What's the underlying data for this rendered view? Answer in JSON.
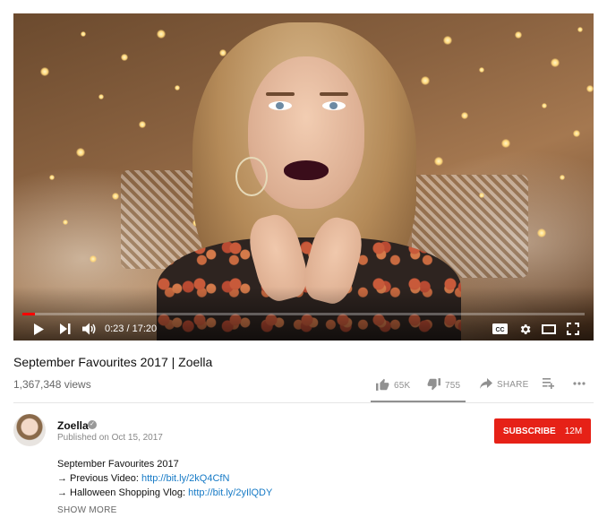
{
  "player": {
    "current_time": "0:23",
    "duration": "17:20",
    "time_display": "0:23 / 17:20",
    "progress_fraction": 0.022,
    "icons": [
      "play-icon",
      "next-icon",
      "volume-icon",
      "captions-icon",
      "settings-icon",
      "theater-mode-icon",
      "fullscreen-icon"
    ],
    "captions_label": "CC"
  },
  "video": {
    "title": "September Favourites 2017 | Zoella",
    "views": "1,367,348 views"
  },
  "actions": {
    "like_count": "65K",
    "dislike_count": "755",
    "share_label": "SHARE",
    "icons": [
      "thumbs-up-icon",
      "thumbs-down-icon",
      "share-icon",
      "add-to-playlist-icon",
      "more-icon"
    ]
  },
  "channel": {
    "name": "Zoella",
    "published": "Published on Oct 15, 2017",
    "subscribe_label": "SUBSCRIBE",
    "subscriber_count": "12M"
  },
  "description": {
    "line1": "September Favourites 2017",
    "line2_prefix": "→ Previous Video: ",
    "line2_link": "http://bit.ly/2kQ4CfN",
    "line3_prefix": "→ Halloween Shopping Vlog: ",
    "line3_link": "http://bit.ly/2yIlQDY",
    "show_more": "SHOW MORE"
  },
  "colors": {
    "accent_red": "#e62117",
    "progress_red": "#ff0000",
    "link_blue": "#167ac6",
    "muted_gray": "#909090"
  }
}
